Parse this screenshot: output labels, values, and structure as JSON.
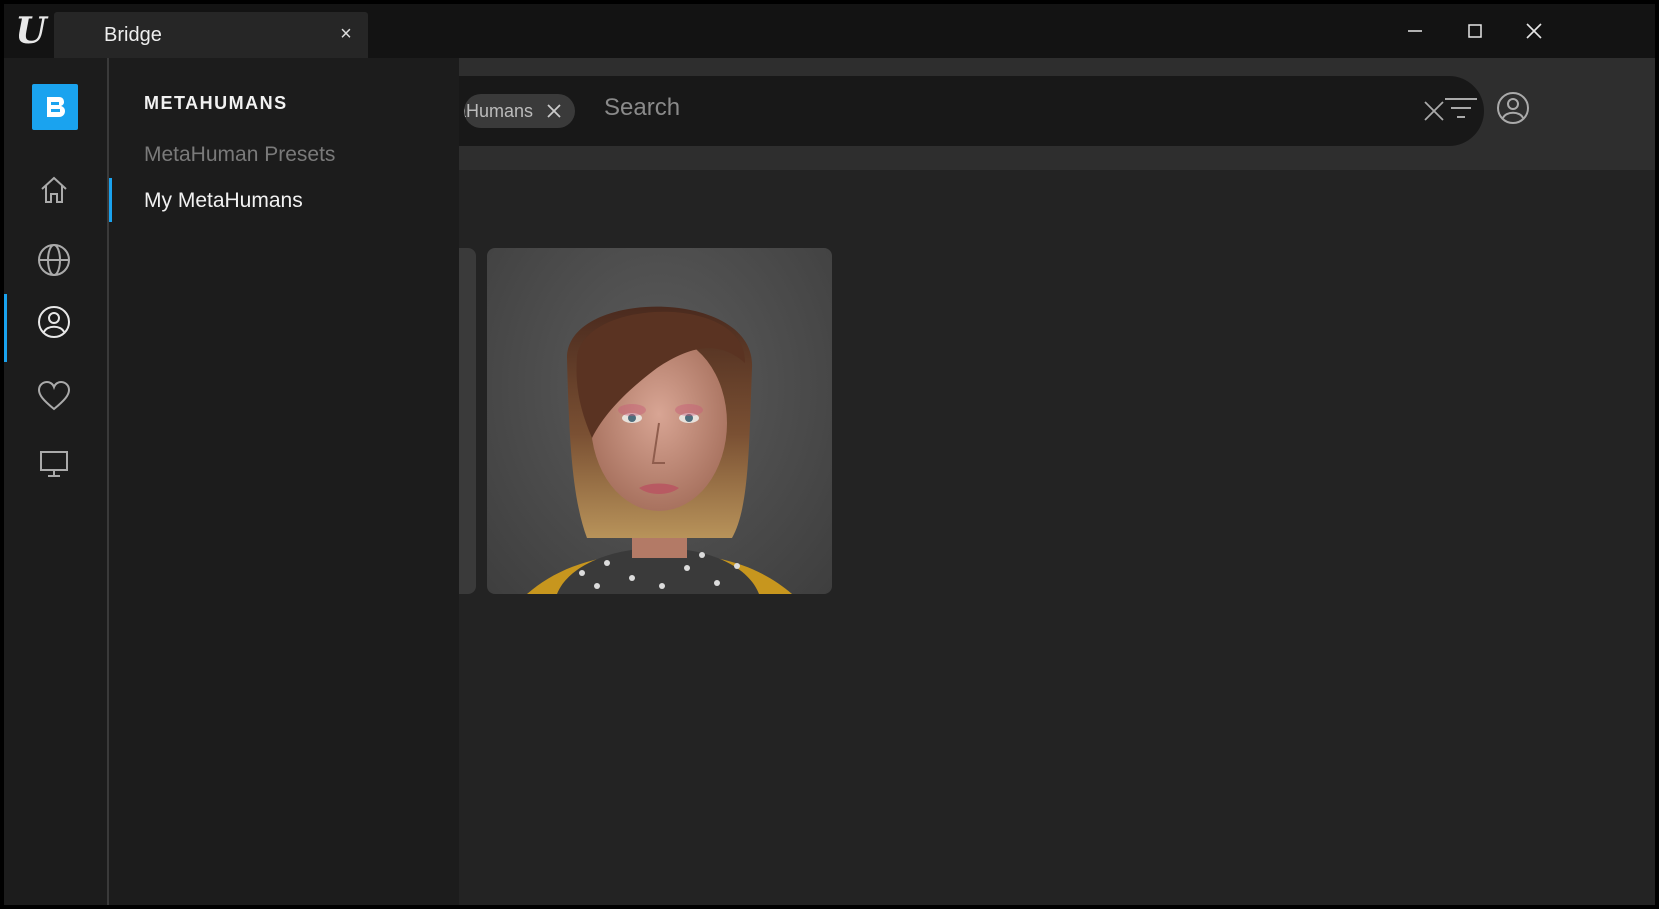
{
  "window": {
    "tab_title": "Bridge",
    "tab_close_glyph": "×"
  },
  "app_logo": "ue-logo",
  "header": {
    "filter_chip_label": "MetaHumans",
    "search_placeholder": "Search"
  },
  "sidebar": {
    "items": [
      {
        "name": "home",
        "icon": "home-icon"
      },
      {
        "name": "globe",
        "icon": "globe-icon"
      },
      {
        "name": "metahumans",
        "icon": "user-circle-icon",
        "active": true
      },
      {
        "name": "favorites",
        "icon": "heart-icon"
      },
      {
        "name": "local",
        "icon": "monitor-icon"
      }
    ]
  },
  "panel": {
    "title": "METAHUMANS",
    "items": [
      {
        "label": "MetaHuman Presets",
        "active": false
      },
      {
        "label": "My MetaHumans",
        "active": true
      }
    ]
  },
  "colors": {
    "accent": "#1aa3ef",
    "background": "#232323",
    "panel": "#1c1c1c",
    "titlebar": "#131313"
  }
}
